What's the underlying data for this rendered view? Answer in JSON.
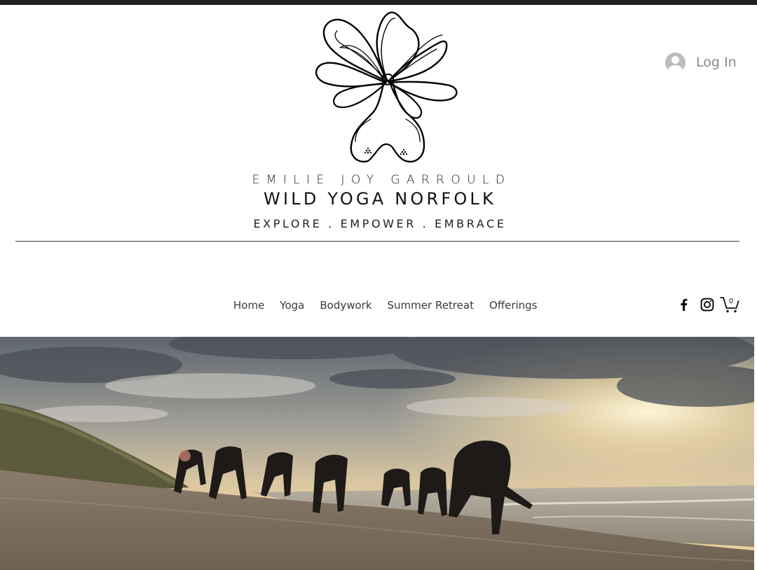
{
  "header": {
    "brand_name": "EMILIE JOY GARROULD",
    "brand_title": "WILD YOGA NORFOLK",
    "tagline": "EXPLORE . EMPOWER . EMBRACE",
    "logo_icon": "flower-logo"
  },
  "login": {
    "label": "Log In",
    "icon": "user-avatar-icon"
  },
  "nav": {
    "items": [
      {
        "label": "Home"
      },
      {
        "label": "Yoga"
      },
      {
        "label": "Bodywork"
      },
      {
        "label": "Summer Retreat"
      },
      {
        "label": "Offerings"
      }
    ]
  },
  "social": {
    "facebook_icon": "facebook-icon",
    "instagram_icon": "instagram-icon"
  },
  "cart": {
    "count": "0",
    "icon": "cart-icon"
  },
  "hero": {
    "image": "group yoga practice on a beach at sunset"
  },
  "colors": {
    "topbar": "#231f1c",
    "text": "#1a1a1a",
    "nav_text": "#3a3a3a",
    "login_text": "#8a8a8a",
    "avatar": "#bdbdbd"
  }
}
